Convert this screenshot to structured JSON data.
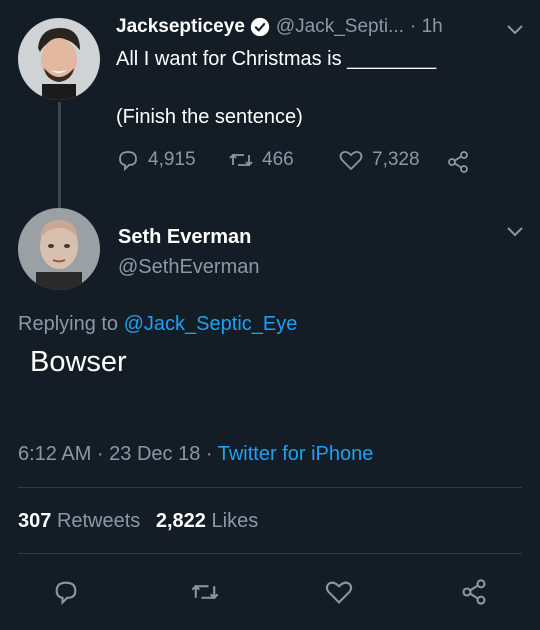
{
  "original_tweet": {
    "display_name": "Jacksepticeye",
    "handle": "@Jack_Septi...",
    "time": "· 1h",
    "text_line1": "All I want for Christmas is ________",
    "text_line2": "(Finish the sentence)",
    "replies": "4,915",
    "retweets": "466",
    "likes": "7,328"
  },
  "reply_tweet": {
    "display_name": "Seth Everman",
    "handle": "@SethEverman",
    "replying_prefix": "Replying to",
    "replying_to": "@Jack_Septic_Eye",
    "text": "Bowser",
    "timestamp": "6:12 AM · 23 Dec 18 ·",
    "source": "Twitter for iPhone",
    "retweet_count": "307",
    "retweet_label": "Retweets",
    "like_count": "2,822",
    "like_label": "Likes"
  },
  "colors": {
    "background": "#141d26",
    "accent": "#1da1f2",
    "muted": "#8899a6"
  },
  "icons": [
    "verified-badge-icon",
    "chevron-down-icon",
    "reply-icon",
    "retweet-icon",
    "like-icon",
    "share-icon"
  ]
}
